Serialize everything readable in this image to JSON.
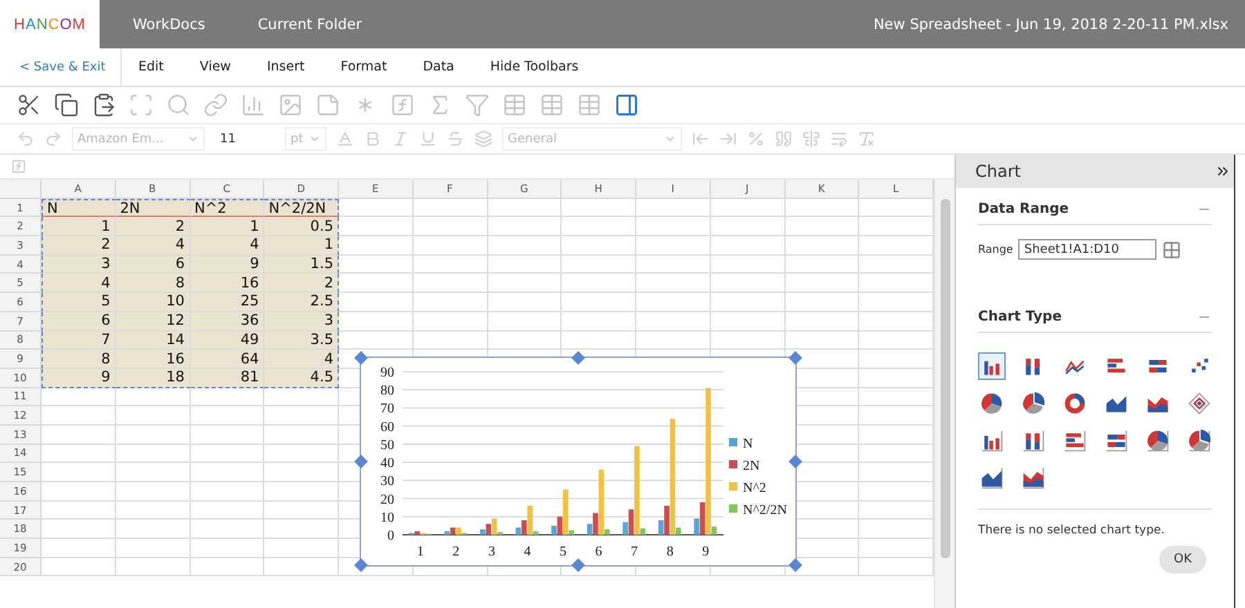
{
  "title_bar": {
    "logo": "HANCOM",
    "nav": [
      "WorkDocs",
      "Current Folder"
    ],
    "file_name": "New Spreadsheet - Jun 19, 2018 2-20-11 PM.xlsx"
  },
  "menu_bar": {
    "back": "< Save & Exit",
    "items": [
      "Edit",
      "View",
      "Insert",
      "Format",
      "Data",
      "Hide Toolbars"
    ]
  },
  "toolbar": [
    {
      "kind": "cut",
      "disabled": false,
      "on": false
    },
    {
      "kind": "copy",
      "disabled": false,
      "on": false
    },
    {
      "kind": "paste",
      "disabled": false,
      "on": false
    },
    {
      "kind": "select",
      "disabled": true,
      "on": false
    },
    {
      "kind": "find",
      "disabled": true,
      "on": false
    },
    {
      "kind": "link",
      "disabled": true,
      "on": false
    },
    {
      "kind": "chart",
      "disabled": true,
      "on": false
    },
    {
      "kind": "image",
      "disabled": true,
      "on": false
    },
    {
      "kind": "shape",
      "disabled": true,
      "on": false
    },
    {
      "kind": "symbol",
      "disabled": true,
      "on": false
    },
    {
      "kind": "function",
      "disabled": true,
      "on": false
    },
    {
      "kind": "sum",
      "disabled": true,
      "on": false
    },
    {
      "kind": "filter",
      "disabled": true,
      "on": false
    },
    {
      "kind": "table",
      "disabled": true,
      "on": false
    },
    {
      "kind": "table",
      "disabled": true,
      "on": false
    },
    {
      "kind": "table",
      "disabled": true,
      "on": false
    },
    {
      "kind": "sidebar",
      "disabled": false,
      "on": true
    }
  ],
  "format_bar": {
    "disabled": true,
    "font": "Amazon Em...",
    "size": "11",
    "unit": "pt",
    "number_format": "General"
  },
  "sheet": {
    "columns": [
      "A",
      "B",
      "C",
      "D",
      "E",
      "F",
      "G",
      "H",
      "I",
      "J",
      "K",
      "L"
    ],
    "rows": [
      {
        "number": "1",
        "kind": "header",
        "selected": true,
        "cells": [
          "N",
          "2N",
          "N^2",
          "N^2/2N"
        ]
      },
      {
        "number": "2",
        "kind": "data",
        "selected": true,
        "cells": [
          "1",
          "2",
          "1",
          "0.5"
        ]
      },
      {
        "number": "3",
        "kind": "data",
        "selected": true,
        "cells": [
          "2",
          "4",
          "4",
          "1"
        ]
      },
      {
        "number": "4",
        "kind": "data",
        "selected": true,
        "cells": [
          "3",
          "6",
          "9",
          "1.5"
        ]
      },
      {
        "number": "5",
        "kind": "data",
        "selected": true,
        "cells": [
          "4",
          "8",
          "16",
          "2"
        ]
      },
      {
        "number": "6",
        "kind": "data",
        "selected": true,
        "cells": [
          "5",
          "10",
          "25",
          "2.5"
        ]
      },
      {
        "number": "7",
        "kind": "data",
        "selected": true,
        "cells": [
          "6",
          "12",
          "36",
          "3"
        ]
      },
      {
        "number": "8",
        "kind": "data",
        "selected": true,
        "cells": [
          "7",
          "14",
          "49",
          "3.5"
        ]
      },
      {
        "number": "9",
        "kind": "data",
        "selected": true,
        "cells": [
          "8",
          "16",
          "64",
          "4"
        ]
      },
      {
        "number": "10",
        "kind": "data",
        "selected": true,
        "cells": [
          "9",
          "18",
          "81",
          "4.5"
        ]
      },
      {
        "number": "11",
        "kind": "data",
        "selected": false,
        "cells": []
      },
      {
        "number": "12",
        "kind": "data",
        "selected": false,
        "cells": []
      },
      {
        "number": "13",
        "kind": "data",
        "selected": false,
        "cells": []
      },
      {
        "number": "14",
        "kind": "data",
        "selected": false,
        "cells": []
      },
      {
        "number": "15",
        "kind": "data",
        "selected": false,
        "cells": []
      },
      {
        "number": "16",
        "kind": "data",
        "selected": false,
        "cells": []
      },
      {
        "number": "17",
        "kind": "data",
        "selected": false,
        "cells": []
      },
      {
        "number": "18",
        "kind": "data",
        "selected": false,
        "cells": []
      },
      {
        "number": "19",
        "kind": "data",
        "selected": false,
        "cells": []
      },
      {
        "number": "20",
        "kind": "data",
        "selected": false,
        "cells": []
      }
    ],
    "chart": {
      "chart_data": {
        "type": "bar",
        "categories": [
          "1",
          "2",
          "3",
          "4",
          "5",
          "6",
          "7",
          "8",
          "9"
        ],
        "series": [
          {
            "name": "N",
            "color": "#5ba4d4",
            "values": [
              1,
              2,
              3,
              4,
              5,
              6,
              7,
              8,
              9
            ]
          },
          {
            "name": "2N",
            "color": "#cc4f4f",
            "values": [
              2,
              4,
              6,
              8,
              10,
              12,
              14,
              16,
              18
            ]
          },
          {
            "name": "N^2",
            "color": "#f0c143",
            "values": [
              1,
              4,
              9,
              16,
              25,
              36,
              49,
              64,
              81
            ]
          },
          {
            "name": "N^2/2N",
            "color": "#7dc95a",
            "values": [
              0.5,
              1,
              1.5,
              2,
              2.5,
              3,
              3.5,
              4,
              4.5
            ]
          }
        ],
        "ylim": [
          0,
          90
        ],
        "yticks": [
          0,
          10,
          20,
          30,
          40,
          50,
          60,
          70,
          80,
          90
        ],
        "grid": true,
        "legend": true
      }
    }
  },
  "panel": {
    "title": "Chart",
    "data_range": {
      "heading": "Data Range",
      "label": "Range",
      "value": "Sheet1!A1:D10"
    },
    "chart_type": {
      "heading": "Chart Type",
      "types": [
        {
          "kind": "column",
          "selected": true
        },
        {
          "kind": "stacked-column",
          "selected": false
        },
        {
          "kind": "line",
          "selected": false
        },
        {
          "kind": "bar",
          "selected": false
        },
        {
          "kind": "stacked-bar",
          "selected": false
        },
        {
          "kind": "scatter",
          "selected": false
        },
        {
          "kind": "pie",
          "selected": false
        },
        {
          "kind": "exploded-pie",
          "selected": false
        },
        {
          "kind": "doughnut",
          "selected": false
        },
        {
          "kind": "area",
          "selected": false
        },
        {
          "kind": "stacked-area",
          "selected": false
        },
        {
          "kind": "radar",
          "selected": false
        },
        {
          "kind": "column-3d",
          "selected": false
        },
        {
          "kind": "stacked-column-3d",
          "selected": false
        },
        {
          "kind": "bar-3d",
          "selected": false
        },
        {
          "kind": "stacked-bar-3d",
          "selected": false
        },
        {
          "kind": "pie-3d",
          "selected": false
        },
        {
          "kind": "exploded-pie-3d",
          "selected": false
        },
        {
          "kind": "area-3d",
          "selected": false
        },
        {
          "kind": "stacked-area-3d",
          "selected": false
        }
      ]
    },
    "message": "There is no selected chart type.",
    "ok": "OK"
  }
}
